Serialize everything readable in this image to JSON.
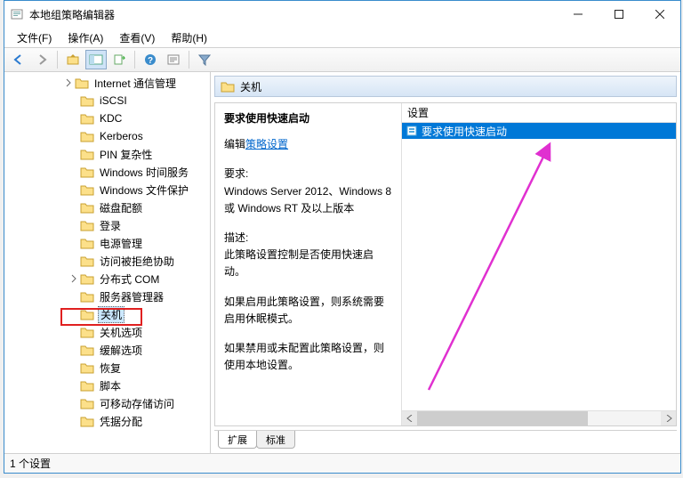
{
  "titlebar": {
    "title": "本地组策略编辑器"
  },
  "menubar": {
    "file": "文件(F)",
    "action": "操作(A)",
    "view": "查看(V)",
    "help": "帮助(H)"
  },
  "tree": {
    "items": [
      {
        "depth": 3,
        "label": "Internet 通信管理",
        "expander": "right"
      },
      {
        "depth": 4,
        "label": "iSCSI"
      },
      {
        "depth": 4,
        "label": "KDC"
      },
      {
        "depth": 4,
        "label": "Kerberos"
      },
      {
        "depth": 4,
        "label": "PIN 复杂性"
      },
      {
        "depth": 4,
        "label": "Windows 时间服务"
      },
      {
        "depth": 4,
        "label": "Windows 文件保护"
      },
      {
        "depth": 4,
        "label": "磁盘配额"
      },
      {
        "depth": 4,
        "label": "登录"
      },
      {
        "depth": 4,
        "label": "电源管理"
      },
      {
        "depth": 4,
        "label": "访问被拒绝协助"
      },
      {
        "depth": 4,
        "label": "分布式 COM",
        "expander": "right"
      },
      {
        "depth": 4,
        "label": "服务器管理器"
      },
      {
        "depth": 4,
        "label": "关机",
        "selected": true,
        "highlighted": true
      },
      {
        "depth": 4,
        "label": "关机选项"
      },
      {
        "depth": 4,
        "label": "缓解选项"
      },
      {
        "depth": 4,
        "label": "恢复"
      },
      {
        "depth": 4,
        "label": "脚本"
      },
      {
        "depth": 4,
        "label": "可移动存储访问"
      },
      {
        "depth": 4,
        "label": "凭据分配"
      }
    ]
  },
  "detail": {
    "header": "关机",
    "selected_title": "要求使用快速启动",
    "edit_prefix": "编辑",
    "edit_link": "策略设置",
    "req_label": "要求:",
    "req_text": "Windows Server 2012、Windows 8 或 Windows RT 及以上版本",
    "desc_label": "描述:",
    "desc_text1": "此策略设置控制是否使用快速启动。",
    "desc_text2": "如果启用此策略设置，则系统需要启用休眠模式。",
    "desc_text3": "如果禁用或未配置此策略设置，则使用本地设置。",
    "col_setting": "设置",
    "list": [
      {
        "label": "要求使用快速启动",
        "selected": true
      }
    ],
    "tabs": {
      "extended": "扩展",
      "standard": "标准"
    }
  },
  "statusbar": {
    "text": "1 个设置"
  }
}
